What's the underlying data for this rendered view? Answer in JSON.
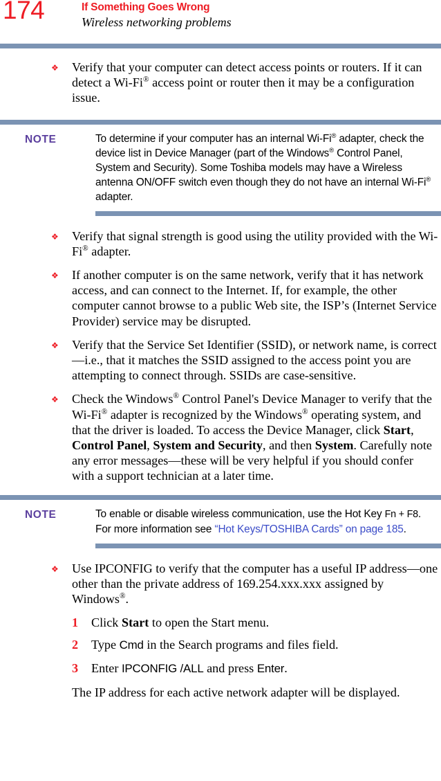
{
  "page": {
    "number": "174",
    "chapter_title": "If Something Goes Wrong",
    "section_title": "Wireless networking problems"
  },
  "colors": {
    "page_number": "#ee1c24",
    "chapter_title": "#ee1c24",
    "rule": "#7b93b3",
    "note_label": "#5b3f9e",
    "bullet": "#ee1c24",
    "step_number": "#ee1c24",
    "link": "#3b4cc8"
  },
  "icons": {
    "bullet": "❖"
  },
  "content": {
    "bullet_1": {
      "text_parts": [
        {
          "t": "Verify that your computer can detect access points or routers. If it can detect a Wi-Fi"
        },
        {
          "t": "®",
          "style": "sup"
        },
        {
          "t": " access point or router then it may be a configuration issue."
        }
      ]
    },
    "note_1": {
      "label": "NOTE",
      "text_parts": [
        {
          "t": "To determine if your computer has an internal Wi-Fi"
        },
        {
          "t": "®",
          "style": "sup"
        },
        {
          "t": " adapter, check the device list in Device Manager (part of the Windows"
        },
        {
          "t": "®",
          "style": "sup"
        },
        {
          "t": " Control Panel, System and Security). Some Toshiba models may have a Wireless antenna ON/OFF switch even though they do not have an internal Wi-Fi"
        },
        {
          "t": "®",
          "style": "sup"
        },
        {
          "t": " adapter."
        }
      ]
    },
    "bullet_2": {
      "text_parts": [
        {
          "t": "Verify that signal strength is good using the utility provided with the Wi-Fi"
        },
        {
          "t": "®",
          "style": "sup"
        },
        {
          "t": " adapter."
        }
      ]
    },
    "bullet_3": {
      "text_parts": [
        {
          "t": "If another computer is on the same network, verify that it has network access, and can connect to the Internet. If, for example, the other computer cannot browse to a public Web site, the ISP’s (Internet Service Provider) service may be disrupted."
        }
      ]
    },
    "bullet_4": {
      "text_parts": [
        {
          "t": "Verify that the Service Set Identifier (SSID), or network name, is correct—i.e., that it matches the SSID assigned to the access point you are attempting to connect through. SSIDs are case-sensitive."
        }
      ]
    },
    "bullet_5": {
      "text_parts": [
        {
          "t": "Check the Windows"
        },
        {
          "t": "®",
          "style": "sup"
        },
        {
          "t": " Control Panel's Device Manager to verify that the Wi-Fi"
        },
        {
          "t": "®",
          "style": "sup"
        },
        {
          "t": " adapter is recognized by the Windows"
        },
        {
          "t": "®",
          "style": "sup"
        },
        {
          "t": " operating system, and that the driver is loaded. To access the Device Manager, click "
        },
        {
          "t": "Start",
          "style": "bold"
        },
        {
          "t": ", "
        },
        {
          "t": "Control Panel",
          "style": "bold"
        },
        {
          "t": ", "
        },
        {
          "t": "System and Security",
          "style": "bold"
        },
        {
          "t": ", and then "
        },
        {
          "t": "System",
          "style": "bold"
        },
        {
          "t": ". Carefully note any error messages—these will be very helpful if you should confer with a support technician at a later time."
        }
      ]
    },
    "note_2": {
      "label": "NOTE",
      "text_parts": [
        {
          "t": "To enable or disable wireless communication, use the Hot Key "
        },
        {
          "t": "Fn + F8",
          "style": "ui"
        },
        {
          "t": ". For more information see "
        },
        {
          "t": "“Hot Keys/TOSHIBA Cards” on page 185",
          "style": "link"
        },
        {
          "t": "."
        }
      ]
    },
    "bullet_6": {
      "text_parts": [
        {
          "t": "Use IPCONFIG to verify that the computer has a useful IP address—one other than the private address of 169.254.xxx.xxx assigned by Windows"
        },
        {
          "t": "®",
          "style": "sup"
        },
        {
          "t": "."
        }
      ]
    },
    "steps": [
      {
        "number": "1",
        "text_parts": [
          {
            "t": "Click "
          },
          {
            "t": "Start",
            "style": "bold"
          },
          {
            "t": " to open the Start menu."
          }
        ]
      },
      {
        "number": "2",
        "text_parts": [
          {
            "t": "Type "
          },
          {
            "t": "Cmd",
            "style": "ui"
          },
          {
            "t": " in the Search programs and files field."
          }
        ]
      },
      {
        "number": "3",
        "text_parts": [
          {
            "t": "Enter "
          },
          {
            "t": "IPCONFIG /ALL",
            "style": "ui"
          },
          {
            "t": " and press "
          },
          {
            "t": "Enter",
            "style": "ui"
          },
          {
            "t": "."
          }
        ]
      }
    ],
    "closing_paragraph": {
      "text_parts": [
        {
          "t": "The IP address for each active network adapter will be displayed."
        }
      ]
    }
  }
}
